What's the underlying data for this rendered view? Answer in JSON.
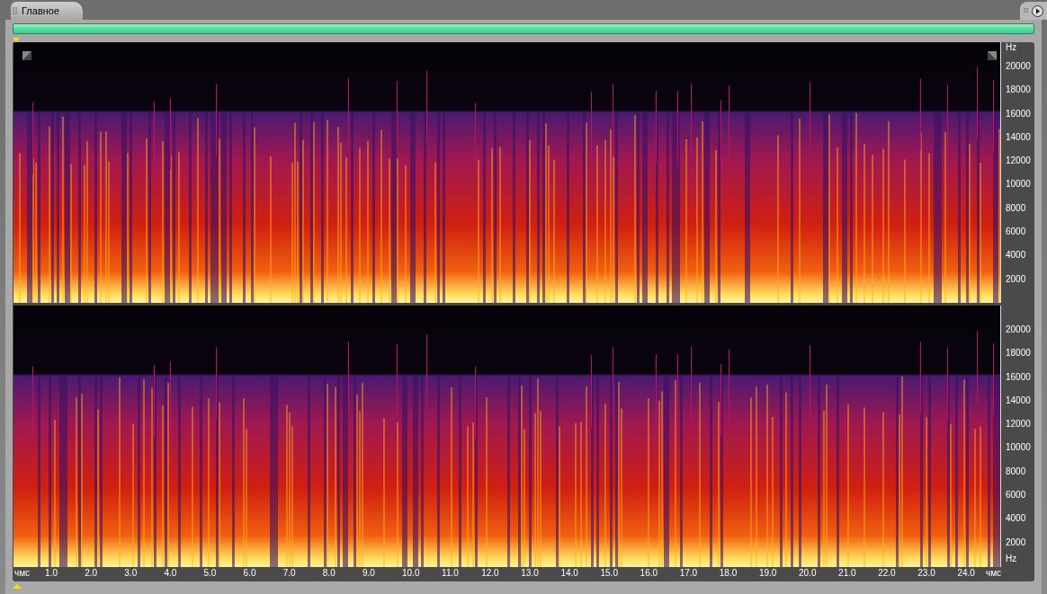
{
  "tab": {
    "label": "Главное"
  },
  "channels": [
    {
      "top_unit": "Hz",
      "frequency_labels": [
        "20000",
        "18000",
        "16000",
        "14000",
        "12000",
        "10000",
        "8000",
        "6000",
        "4000",
        "2000"
      ]
    },
    {
      "frequency_labels": [
        "20000",
        "18000",
        "16000",
        "14000",
        "12000",
        "10000",
        "8000",
        "6000",
        "4000",
        "2000"
      ],
      "bottom_unit": "Hz"
    }
  ],
  "time_axis": {
    "unit": "чмс",
    "labels": [
      "1.0",
      "2.0",
      "3.0",
      "4.0",
      "5.0",
      "6.0",
      "7.0",
      "8.0",
      "9.0",
      "10.0",
      "11.0",
      "12.0",
      "13.0",
      "14.0",
      "15.0",
      "16.0",
      "17.0",
      "18.0",
      "19.0",
      "20.0",
      "21.0",
      "22.0",
      "23.0",
      "24.0"
    ],
    "end_unit": "чмс"
  }
}
